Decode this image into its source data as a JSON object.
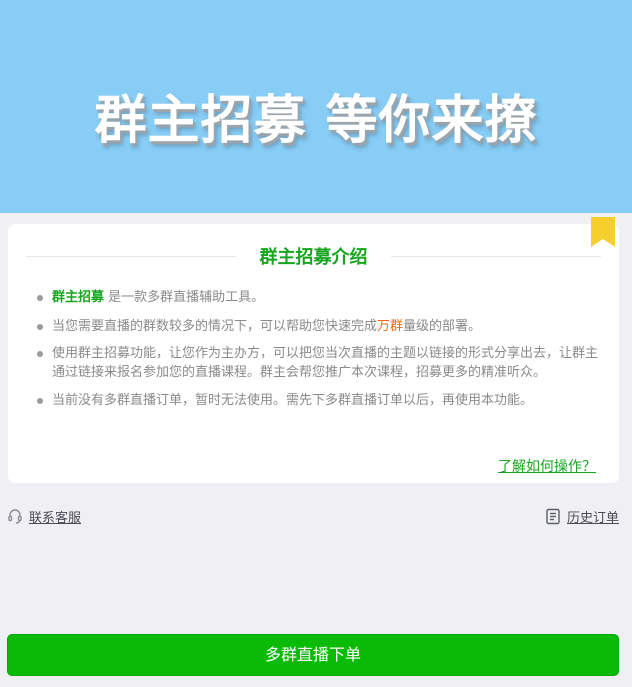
{
  "banner": {
    "title": "群主招募 等你来撩"
  },
  "card": {
    "title": "群主招募介绍",
    "items": [
      {
        "highlight": "群主招募",
        "text": " 是一款多群直播辅助工具。"
      },
      {
        "text_before": "当您需要直播的群数较多的情况下，可以帮助您快速完成",
        "highlight": "万群",
        "text_after": "量级的部署。"
      },
      {
        "text": "使用群主招募功能，让您作为主办方，可以把您当次直播的主题以链接的形式分享出去，让群主通过链接来报名参加您的直播课程。群主会帮您推广本次课程，招募更多的精准听众。"
      },
      {
        "text": "当前没有多群直播订单，暂时无法使用。需先下多群直播订单以后，再使用本功能。"
      }
    ],
    "howto_link": "了解如何操作？",
    "bookmark_color": "#f6cf2d"
  },
  "links": {
    "contact": "联系客服",
    "history": "历史订单"
  },
  "order_button": "多群直播下单",
  "colors": {
    "banner": "#87cdf6",
    "accent_green": "#17a51f",
    "button_green": "#09bb07",
    "highlight_orange": "#f06a10",
    "background": "#efeff4"
  }
}
